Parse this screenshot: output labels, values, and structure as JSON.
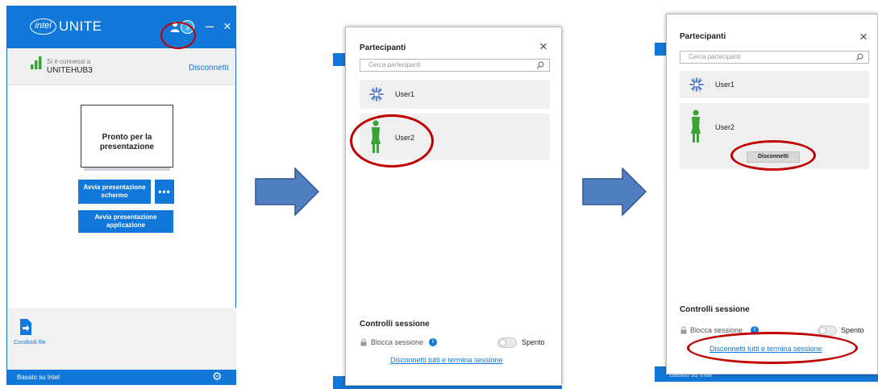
{
  "main_window": {
    "logo_intel": "intel",
    "app_name": "UNITE",
    "participants_count": "3",
    "minimize": "–",
    "close": "×",
    "connected_label": "Si è connessi a",
    "hub_name": "UNITEHUB3",
    "disconnect_link": "Disconnetti",
    "screen_status_line1": "Pronto per la",
    "screen_status_line2": "presentazione",
    "btn_present_screen_line1": "Avvia presentazione",
    "btn_present_screen_line2": "schermo",
    "btn_more": "•••",
    "btn_present_app_line1": "Avvia presentazione",
    "btn_present_app_line2": "applicazione",
    "share_file_label": "Condividi file",
    "footer_text": "Basato su Intel",
    "accent_color": "#1177d9"
  },
  "participants_panel_a": {
    "title": "Partecipanti",
    "close": "×",
    "search_placeholder": "Cerca partecipanti",
    "users": [
      {
        "name": "User1",
        "avatar": "flower-avatar-icon"
      },
      {
        "name": "User2",
        "avatar": "person-green-avatar-icon"
      }
    ],
    "session_controls_title": "Controlli sessione",
    "lock_session_label": "Blocca sessione",
    "toggle_state": "Spento",
    "disconnect_all_link": "Disconnetti tutti e termina sessione"
  },
  "participants_panel_b": {
    "title": "Partecipanti",
    "close": "×",
    "search_placeholder": "Cerca partecipanti",
    "users": [
      {
        "name": "User1",
        "avatar": "flower-avatar-icon"
      },
      {
        "name": "User2",
        "avatar": "person-green-avatar-icon"
      }
    ],
    "user_disconnect_button": "Disconnetti",
    "session_controls_title": "Controlli sessione",
    "lock_session_label": "Blocca sessione",
    "toggle_state": "Spento",
    "disconnect_all_link": "Disconnetti tutti e termina sessione",
    "footer_text_partial": "Basato su Intel"
  },
  "annotation_color": "#c00000",
  "arrow_color": "#4f7fbf"
}
